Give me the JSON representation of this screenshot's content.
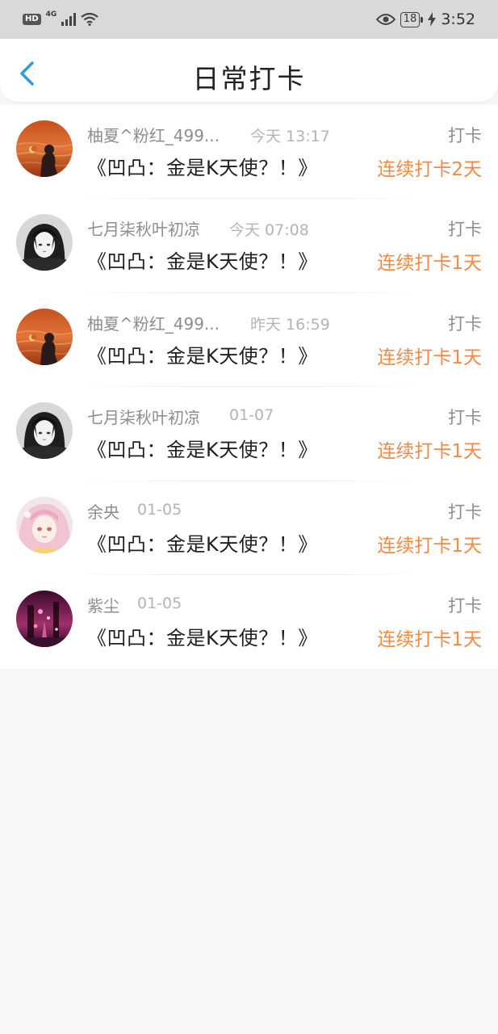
{
  "status_bar": {
    "hd": "HD",
    "network": "4G",
    "battery": "18",
    "time": "3:52",
    "icons": [
      "hd-icon",
      "signal-icon",
      "wifi-icon",
      "eye-icon",
      "battery-icon",
      "charging-icon"
    ]
  },
  "header": {
    "title": "日常打卡",
    "back_icon": "chevron-left-icon",
    "accent": "#2e9ae6"
  },
  "colors": {
    "streak": "#f08a45",
    "name": "#8d8d8d",
    "date": "#b4b4b4"
  },
  "entries": [
    {
      "name": "柚夏^粉红_499...",
      "date": "今天 13:17",
      "action": "打卡",
      "book": "《凹凸：金是K天使？！》",
      "streak": "连续打卡2天",
      "avatar": "sunset-sea-avatar"
    },
    {
      "name": "七月柒秋叶初凉",
      "date": "今天 07:08",
      "action": "打卡",
      "book": "《凹凸：金是K天使？！》",
      "streak": "连续打卡1天",
      "avatar": "anime-girl-bw-avatar"
    },
    {
      "name": "柚夏^粉红_499...",
      "date": "昨天 16:59",
      "action": "打卡",
      "book": "《凹凸：金是K天使？！》",
      "streak": "连续打卡1天",
      "avatar": "sunset-sea-avatar"
    },
    {
      "name": "七月柒秋叶初凉",
      "date": "01-07",
      "action": "打卡",
      "book": "《凹凸：金是K天使？！》",
      "streak": "连续打卡1天",
      "avatar": "anime-girl-bw-avatar"
    },
    {
      "name": "余央",
      "date": "01-05",
      "action": "打卡",
      "book": "《凹凸：金是K天使？！》",
      "streak": "连续打卡1天",
      "avatar": "pink-hair-girl-avatar"
    },
    {
      "name": "紫尘",
      "date": "01-05",
      "action": "打卡",
      "book": "《凹凸：金是K天使？！》",
      "streak": "连续打卡1天",
      "avatar": "pink-night-scene-avatar"
    }
  ]
}
